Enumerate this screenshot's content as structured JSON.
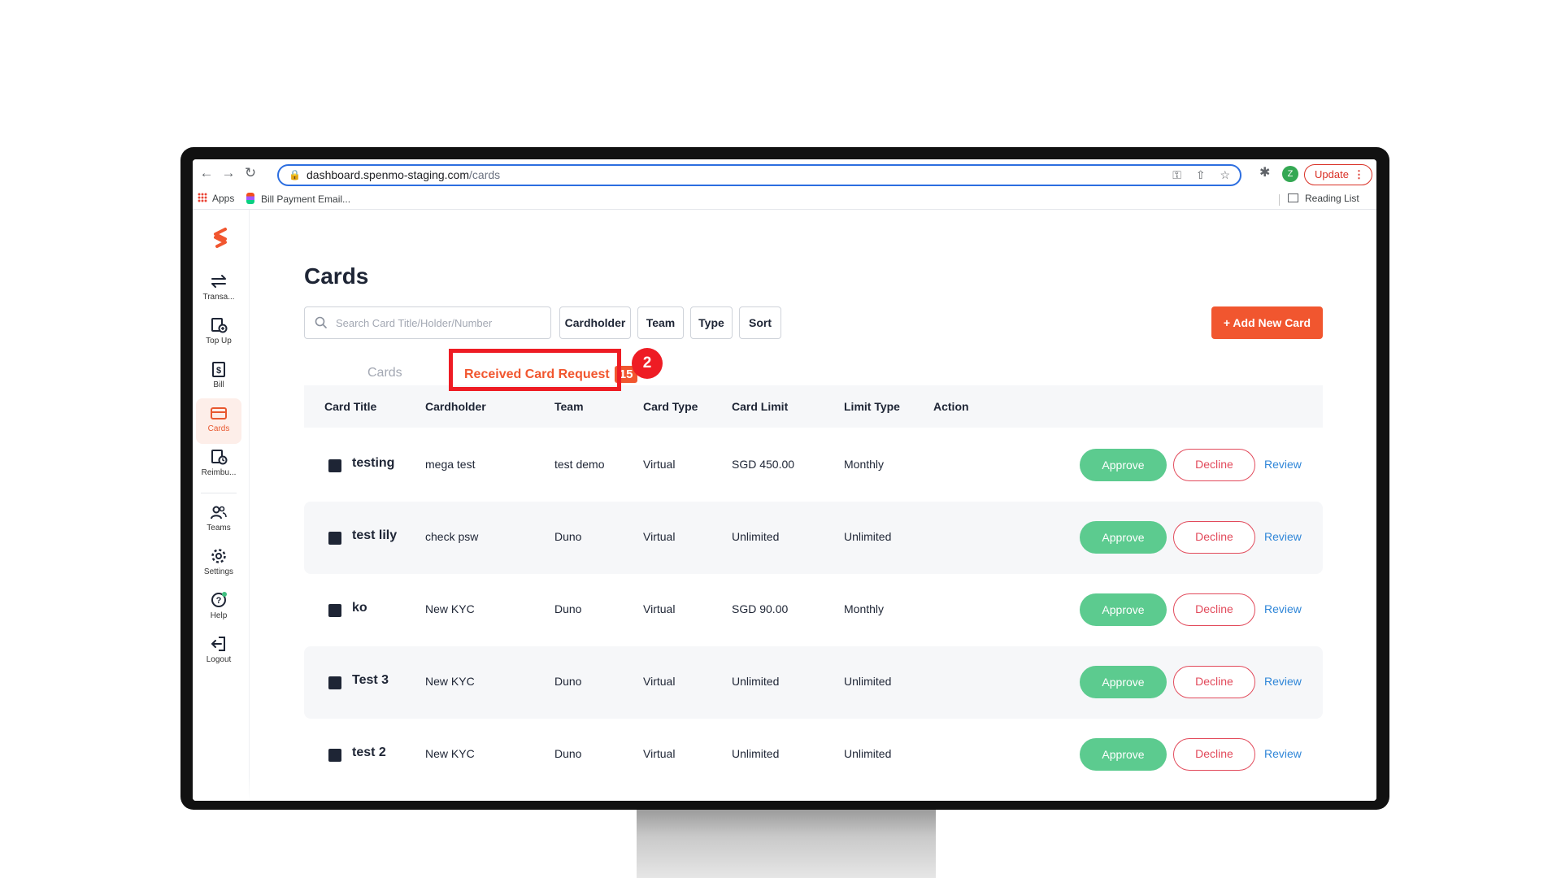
{
  "browser": {
    "url_host": "dashboard.spenmo-staging.com",
    "url_path": "/cards",
    "update_label": "Update",
    "profile_initial": "Z",
    "bookmarks": [
      {
        "label": "Apps"
      },
      {
        "label": "Bill Payment Email..."
      }
    ],
    "reading_list_label": "Reading List"
  },
  "sidebar": {
    "items": [
      {
        "label": "Transa...",
        "icon": "transfer-icon"
      },
      {
        "label": "Top Up",
        "icon": "topup-icon"
      },
      {
        "label": "Bill",
        "icon": "bill-icon"
      },
      {
        "label": "Cards",
        "icon": "card-icon",
        "active": true
      },
      {
        "label": "Reimbu...",
        "icon": "reimburse-icon"
      },
      {
        "label": "Teams",
        "icon": "teams-icon"
      },
      {
        "label": "Settings",
        "icon": "gear-icon"
      },
      {
        "label": "Help",
        "icon": "help-icon"
      },
      {
        "label": "Logout",
        "icon": "logout-icon"
      }
    ]
  },
  "page": {
    "title": "Cards",
    "search_placeholder": "Search Card Title/Holder/Number",
    "filters": [
      "Cardholder",
      "Team",
      "Type",
      "Sort"
    ],
    "add_button": "+ Add New Card",
    "tabs": {
      "cards": "Cards",
      "received": "Received Card Request",
      "received_count": "15"
    },
    "step_marker": "2"
  },
  "table": {
    "headers": [
      "Card Title",
      "Cardholder",
      "Team",
      "Card Type",
      "Card Limit",
      "Limit Type",
      "Action"
    ],
    "action_labels": {
      "approve": "Approve",
      "decline": "Decline",
      "review": "Review"
    },
    "rows": [
      {
        "title": "testing",
        "cardholder": "mega test",
        "team": "test demo",
        "type": "Virtual",
        "limit": "SGD 450.00",
        "limit_type": "Monthly"
      },
      {
        "title": "test lily",
        "cardholder": "check psw",
        "team": "Duno",
        "type": "Virtual",
        "limit": "Unlimited",
        "limit_type": "Unlimited"
      },
      {
        "title": "ko",
        "cardholder": "New KYC",
        "team": "Duno",
        "type": "Virtual",
        "limit": "SGD 90.00",
        "limit_type": "Monthly"
      },
      {
        "title": "Test 3",
        "cardholder": "New KYC",
        "team": "Duno",
        "type": "Virtual",
        "limit": "Unlimited",
        "limit_type": "Unlimited"
      },
      {
        "title": "test 2",
        "cardholder": "New KYC",
        "team": "Duno",
        "type": "Virtual",
        "limit": "Unlimited",
        "limit_type": "Unlimited"
      }
    ]
  },
  "colors": {
    "brand": "#f1562f",
    "approve": "#5ccb8f",
    "decline": "#e24a5b",
    "link": "#2f86d8",
    "annotation": "#ee1c24"
  }
}
